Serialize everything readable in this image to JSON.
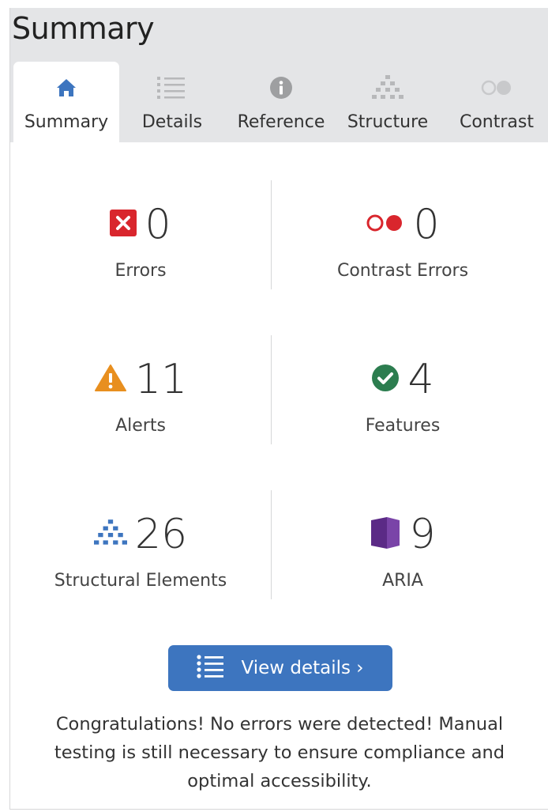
{
  "header": {
    "title": "Summary"
  },
  "tabs": [
    {
      "label": "Summary",
      "icon": "home-icon",
      "active": true
    },
    {
      "label": "Details",
      "icon": "list-icon",
      "active": false
    },
    {
      "label": "Reference",
      "icon": "info-icon",
      "active": false
    },
    {
      "label": "Structure",
      "icon": "structure-icon",
      "active": false
    },
    {
      "label": "Contrast",
      "icon": "contrast-icon",
      "active": false
    }
  ],
  "stats": {
    "errors": {
      "value": "0",
      "label": "Errors",
      "icon": "error-icon",
      "color": "#d9262d"
    },
    "contrast_errors": {
      "value": "0",
      "label": "Contrast Errors",
      "icon": "contrast-error-icon",
      "color": "#d9262d"
    },
    "alerts": {
      "value": "11",
      "label": "Alerts",
      "icon": "alert-icon",
      "color": "#e88f1f"
    },
    "features": {
      "value": "4",
      "label": "Features",
      "icon": "feature-check-icon",
      "color": "#2c7d4f"
    },
    "structural_elements": {
      "value": "26",
      "label": "Structural Elements",
      "icon": "structure-icon",
      "color": "#3d75bf"
    },
    "aria": {
      "value": "9",
      "label": "ARIA",
      "icon": "aria-icon",
      "color": "#5b2a86"
    }
  },
  "view_details": {
    "label": "View details ›",
    "icon": "list-icon"
  },
  "message": "Congratulations! No errors were detected! Manual testing is still necessary to ensure compliance and optimal accessibility.",
  "colors": {
    "accent": "#3d75bf",
    "header_bg": "#e4e5e7"
  }
}
